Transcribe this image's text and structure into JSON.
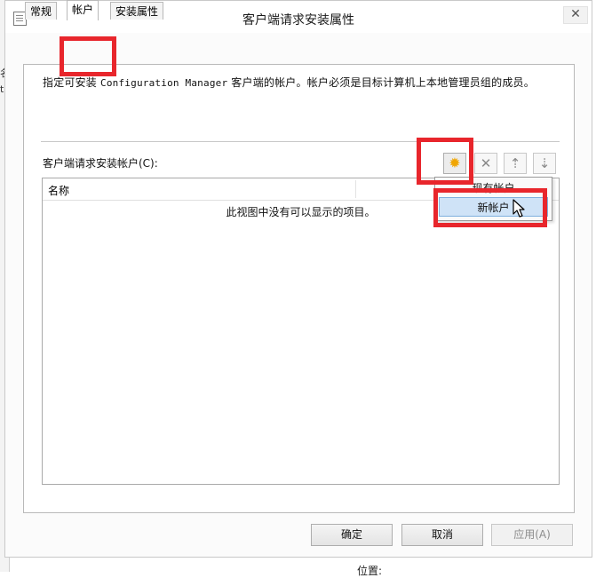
{
  "background": {
    "left_fragments": [
      "名",
      "t"
    ],
    "bottom_text": "位置:"
  },
  "window": {
    "title": "客户端请求安装属性",
    "close_symbol": "✕"
  },
  "tabs": [
    {
      "label": "常规",
      "active": false
    },
    {
      "label": "帐户",
      "active": true
    },
    {
      "label": "安装属性",
      "active": false
    }
  ],
  "panel": {
    "description_prefix": "指定可安装 ",
    "description_product": "Configuration Manager",
    "description_suffix": " 客户端的帐户。帐户必须是目标计算机上本地管理员组的成员。",
    "section_label": "客户端请求安装帐户(C):",
    "list_header_name": "名称",
    "empty_message": "此视图中没有可以显示的项目。"
  },
  "toolbar": {
    "new_icon": "new-starburst-icon",
    "delete_icon": "delete-x-icon",
    "move_up_icon": "move-up-icon",
    "move_down_icon": "move-down-icon"
  },
  "dropdown": {
    "items": [
      "现有帐户",
      "新帐户"
    ],
    "selected_index": 1
  },
  "buttons": {
    "ok": "确定",
    "cancel": "取消",
    "apply": "应用(A)"
  },
  "colors": {
    "highlight_box": "#e8262c",
    "menu_hover": "#cfe3f7",
    "new_icon": "#f0a500"
  }
}
